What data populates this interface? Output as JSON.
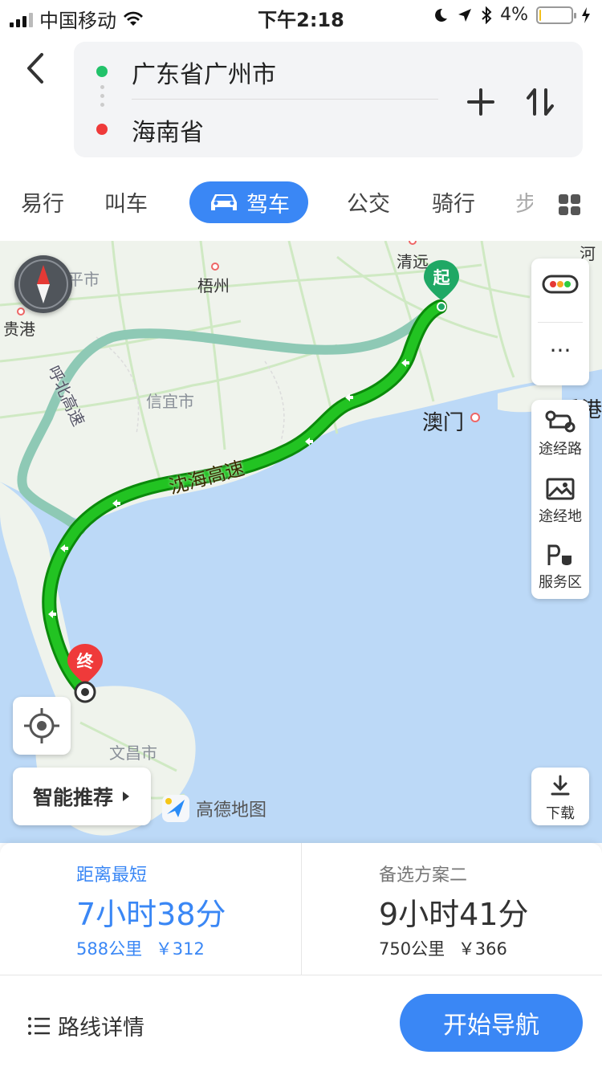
{
  "status_bar": {
    "carrier": "中国移动",
    "time": "下午2:18",
    "battery_text": "4%",
    "battery_level": 0.04
  },
  "header": {
    "start": "广东省广州市",
    "end": "海南省"
  },
  "tabs": [
    {
      "label": "易行"
    },
    {
      "label": "叫车"
    },
    {
      "label": "驾车"
    },
    {
      "label": "公交"
    },
    {
      "label": "骑行"
    },
    {
      "label": "步"
    }
  ],
  "active_tab": "驾车",
  "map": {
    "labels": {
      "qingyuan": "清远",
      "heyuan": "河",
      "wuzhou": "梧州",
      "guiping": "桂平市",
      "guigang": "贵港",
      "xinyi": "信宜市",
      "macau": "澳门",
      "hongkong": "香港",
      "wenchang": "文昌市",
      "highway_main": "沈海高速",
      "highway_alt": "呼北高速"
    },
    "start_marker": "起",
    "end_marker": "终",
    "controls": {
      "waypoint_route": "途经路",
      "waypoint_place": "途经地",
      "service_area": "服务区",
      "download": "下载"
    },
    "smart_recommend": "智能推荐",
    "brand": "高德地图"
  },
  "plans": [
    {
      "title": "距离最短",
      "time": "7小时38分",
      "distance": "588公里",
      "toll": "￥312"
    },
    {
      "title": "备选方案二",
      "time": "9小时41分",
      "distance": "750公里",
      "toll": "￥366"
    }
  ],
  "footer": {
    "details": "路线详情",
    "start_nav": "开始导航"
  },
  "colors": {
    "accent": "#3a87f5",
    "route": "#1fb31f",
    "alt_route": "#8ec9b5",
    "sea": "#bcd9f7"
  }
}
